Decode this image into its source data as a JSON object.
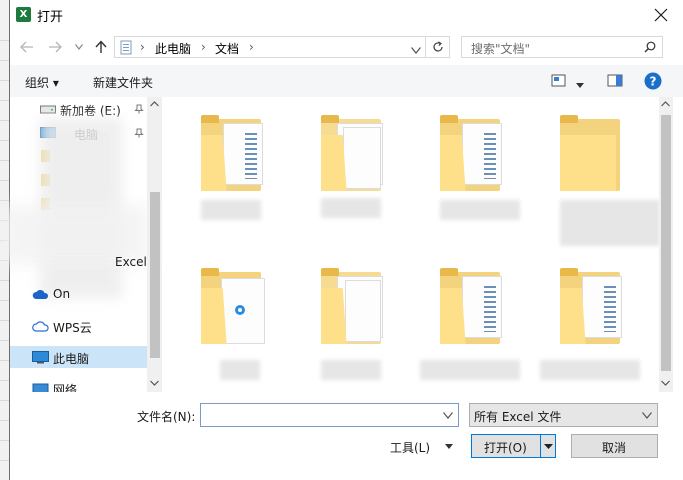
{
  "window": {
    "title": "打开",
    "app_icon_letter": "X"
  },
  "address_bar": {
    "crumbs": [
      "此电脑",
      "文档"
    ],
    "separator": "›"
  },
  "search": {
    "placeholder": "搜索\"文档\""
  },
  "toolbar": {
    "organize_label": "组织 ▾",
    "new_folder_label": "新建文件夹"
  },
  "sidebar": {
    "items": [
      {
        "label": "新加卷 (E:)",
        "icon": "drive-icon"
      },
      {
        "label": "电脑",
        "icon": "desktop-icon"
      },
      {
        "label": "Excel",
        "icon": "folder-icon"
      },
      {
        "label": "On",
        "icon": "onedrive-icon"
      },
      {
        "label": "WPS云",
        "icon": "wps-cloud-icon"
      },
      {
        "label": "此电脑",
        "icon": "computer-icon",
        "selected": true
      },
      {
        "label": "网络",
        "icon": "network-icon"
      }
    ]
  },
  "files": [
    {
      "label": "",
      "variant": "folder-doc"
    },
    {
      "label": "",
      "variant": "folder-papers"
    },
    {
      "label": "",
      "variant": "folder-doc"
    },
    {
      "label": "",
      "variant": "folder-plain"
    },
    {
      "label": "",
      "variant": "folder-ie"
    },
    {
      "label": "",
      "variant": "folder-papers"
    },
    {
      "label": "",
      "variant": "folder-doc"
    },
    {
      "label": "",
      "variant": "folder-doc"
    }
  ],
  "bottom": {
    "filename_label": "文件名(N):",
    "filename_value": "",
    "filetype_value": "所有 Excel 文件",
    "tools_label": "工具(L)",
    "open_label": "打开(O)",
    "cancel_label": "取消"
  },
  "colors": {
    "accent": "#0078d7",
    "selection": "#cce4f7",
    "folder": "#f3d37d"
  }
}
